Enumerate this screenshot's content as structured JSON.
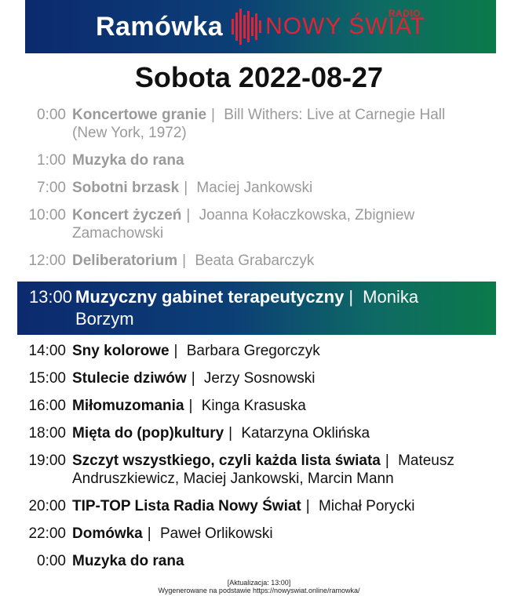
{
  "header": {
    "title": "Ramówka",
    "logo_text": "NOWY ŚWIAT",
    "logo_radio": "RADIO"
  },
  "date_heading": "Sobota 2022-08-27",
  "separator": "|",
  "past": [
    {
      "time": "0:00",
      "title": "Koncertowe granie",
      "host": "Bill Withers: Live at Carnegie Hall (New York, 1972)"
    },
    {
      "time": "1:00",
      "title": "Muzyka do rana",
      "host": ""
    },
    {
      "time": "7:00",
      "title": "Sobotni brzask",
      "host": "Maciej Jankowski"
    },
    {
      "time": "10:00",
      "title": "Koncert życzeń",
      "host": "Joanna Kołaczkowska, Zbigniew Zamachowski"
    },
    {
      "time": "12:00",
      "title": "Deliberatorium",
      "host": "Beata Grabarczyk"
    }
  ],
  "current": {
    "time": "13:00",
    "title": "Muzyczny gabinet terapeutyczny",
    "host": "Monika Borzym"
  },
  "future": [
    {
      "time": "14:00",
      "title": "Sny kolorowe",
      "host": "Barbara Gregorczyk"
    },
    {
      "time": "15:00",
      "title": "Stulecie dziwów",
      "host": "Jerzy Sosnowski"
    },
    {
      "time": "16:00",
      "title": "Miłomuzomania",
      "host": "Kinga Krasuska"
    },
    {
      "time": "18:00",
      "title": "Mięta do (pop)kultury",
      "host": "Katarzyna Oklińska"
    },
    {
      "time": "19:00",
      "title": "Szczyt wszystkiego, czyli każda lista świata",
      "host": "Mateusz Andruszkiewicz, Maciej Jankowski, Marcin Mann"
    },
    {
      "time": "20:00",
      "title": "TIP-TOP Lista Radia Nowy Świat",
      "host": "Michał Porycki"
    },
    {
      "time": "22:00",
      "title": "Domówka",
      "host": "Paweł Orlikowski"
    },
    {
      "time": "0:00",
      "title": "Muzyka do rana",
      "host": ""
    }
  ],
  "footer": {
    "updated": "[Aktualizacja: 13:00]",
    "generated": "Wygenerowane na podstawie https://nowyswiat.online/ramowka/"
  },
  "colors": {
    "header_start": "#0c2a6f",
    "header_end": "#0b7a49",
    "logo_red": "#e02433"
  }
}
